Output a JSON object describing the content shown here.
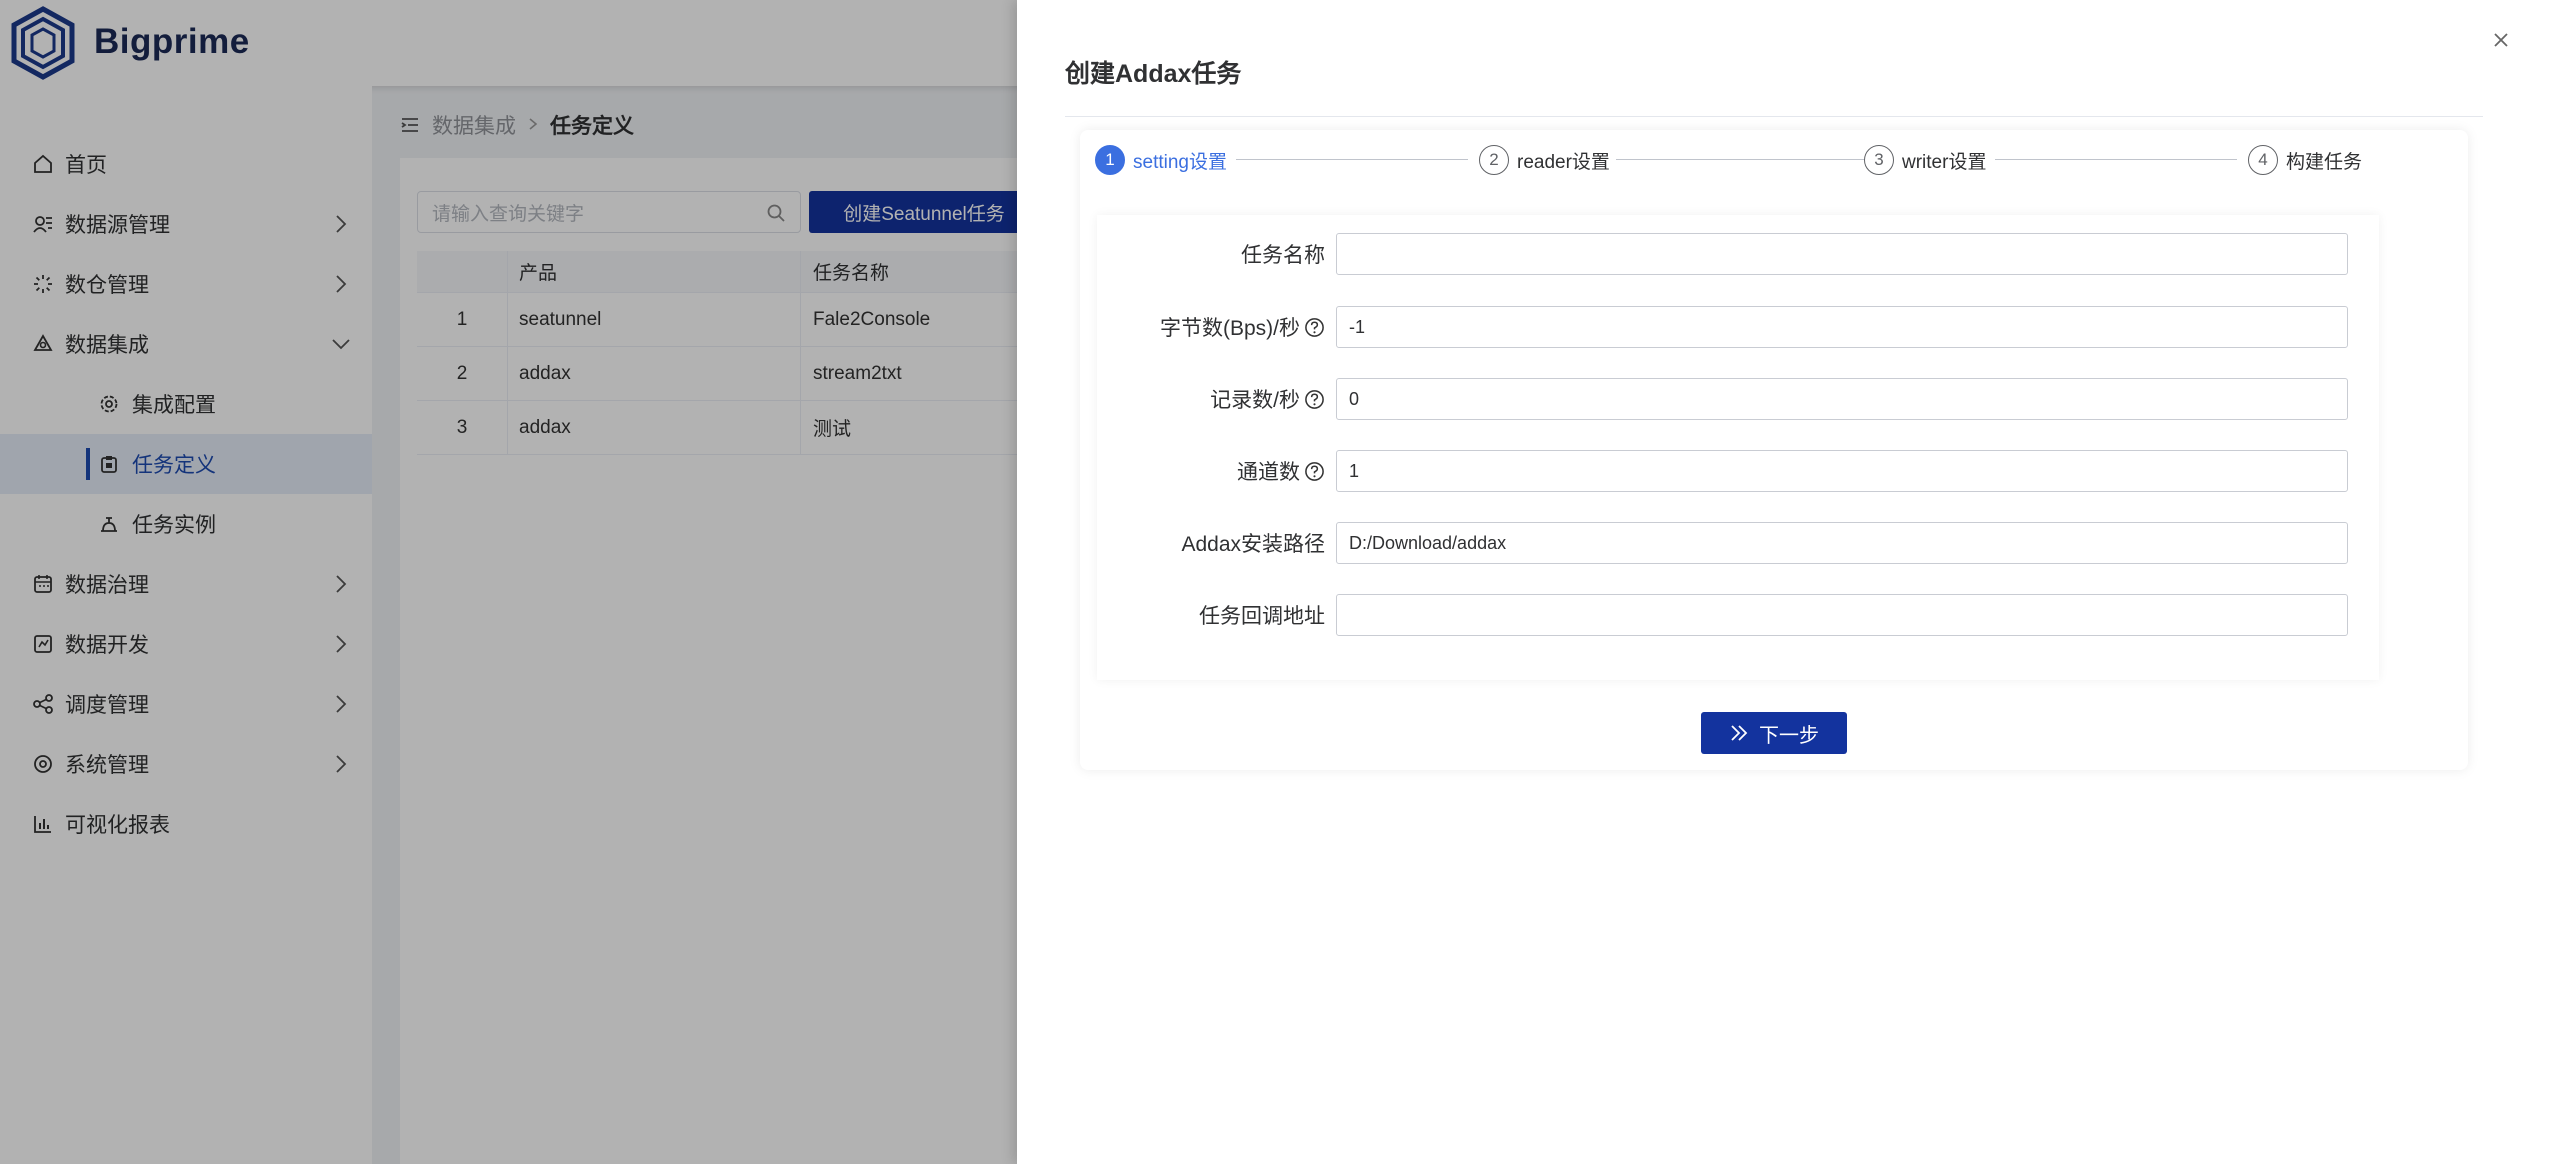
{
  "app": {
    "brand": "Bigprime"
  },
  "sidebar": {
    "items": [
      {
        "label": "首页",
        "icon": "home-icon"
      },
      {
        "label": "数据源管理",
        "icon": "datasource-icon"
      },
      {
        "label": "数仓管理",
        "icon": "warehouse-icon"
      },
      {
        "label": "数据集成",
        "icon": "integration-icon"
      },
      {
        "label": "集成配置",
        "icon": "gear-icon"
      },
      {
        "label": "任务定义",
        "icon": "task-icon"
      },
      {
        "label": "任务实例",
        "icon": "instance-icon"
      },
      {
        "label": "数据治理",
        "icon": "governance-icon"
      },
      {
        "label": "数据开发",
        "icon": "dev-icon"
      },
      {
        "label": "调度管理",
        "icon": "share-icon"
      },
      {
        "label": "系统管理",
        "icon": "settings-icon"
      },
      {
        "label": "可视化报表",
        "icon": "chart-icon"
      }
    ]
  },
  "breadcrumb": {
    "parent": "数据集成",
    "current": "任务定义"
  },
  "toolbar": {
    "search_placeholder": "请输入查询关键字",
    "create_label": "创建Seatunnel任务"
  },
  "table": {
    "headers": [
      "",
      "产品",
      "任务名称"
    ],
    "rows": [
      [
        "1",
        "seatunnel",
        "Fale2Console"
      ],
      [
        "2",
        "addax",
        "stream2txt"
      ],
      [
        "3",
        "addax",
        "测试"
      ]
    ]
  },
  "drawer": {
    "title": "创建Addax任务",
    "steps": [
      {
        "num": "1",
        "label": "setting设置"
      },
      {
        "num": "2",
        "label": "reader设置"
      },
      {
        "num": "3",
        "label": "writer设置"
      },
      {
        "num": "4",
        "label": "构建任务"
      }
    ],
    "fields": [
      {
        "label": "任务名称",
        "value": ""
      },
      {
        "label": "字节数(Bps)/秒",
        "value": "-1"
      },
      {
        "label": "记录数/秒",
        "value": "0"
      },
      {
        "label": "通道数",
        "value": "1"
      },
      {
        "label": "Addax安装路径",
        "value": "D:/Download/addax"
      },
      {
        "label": "任务回调地址",
        "value": ""
      }
    ],
    "next_label": "下一步"
  },
  "colors": {
    "primary": "#13339e",
    "step_active": "#3b6fe0"
  }
}
